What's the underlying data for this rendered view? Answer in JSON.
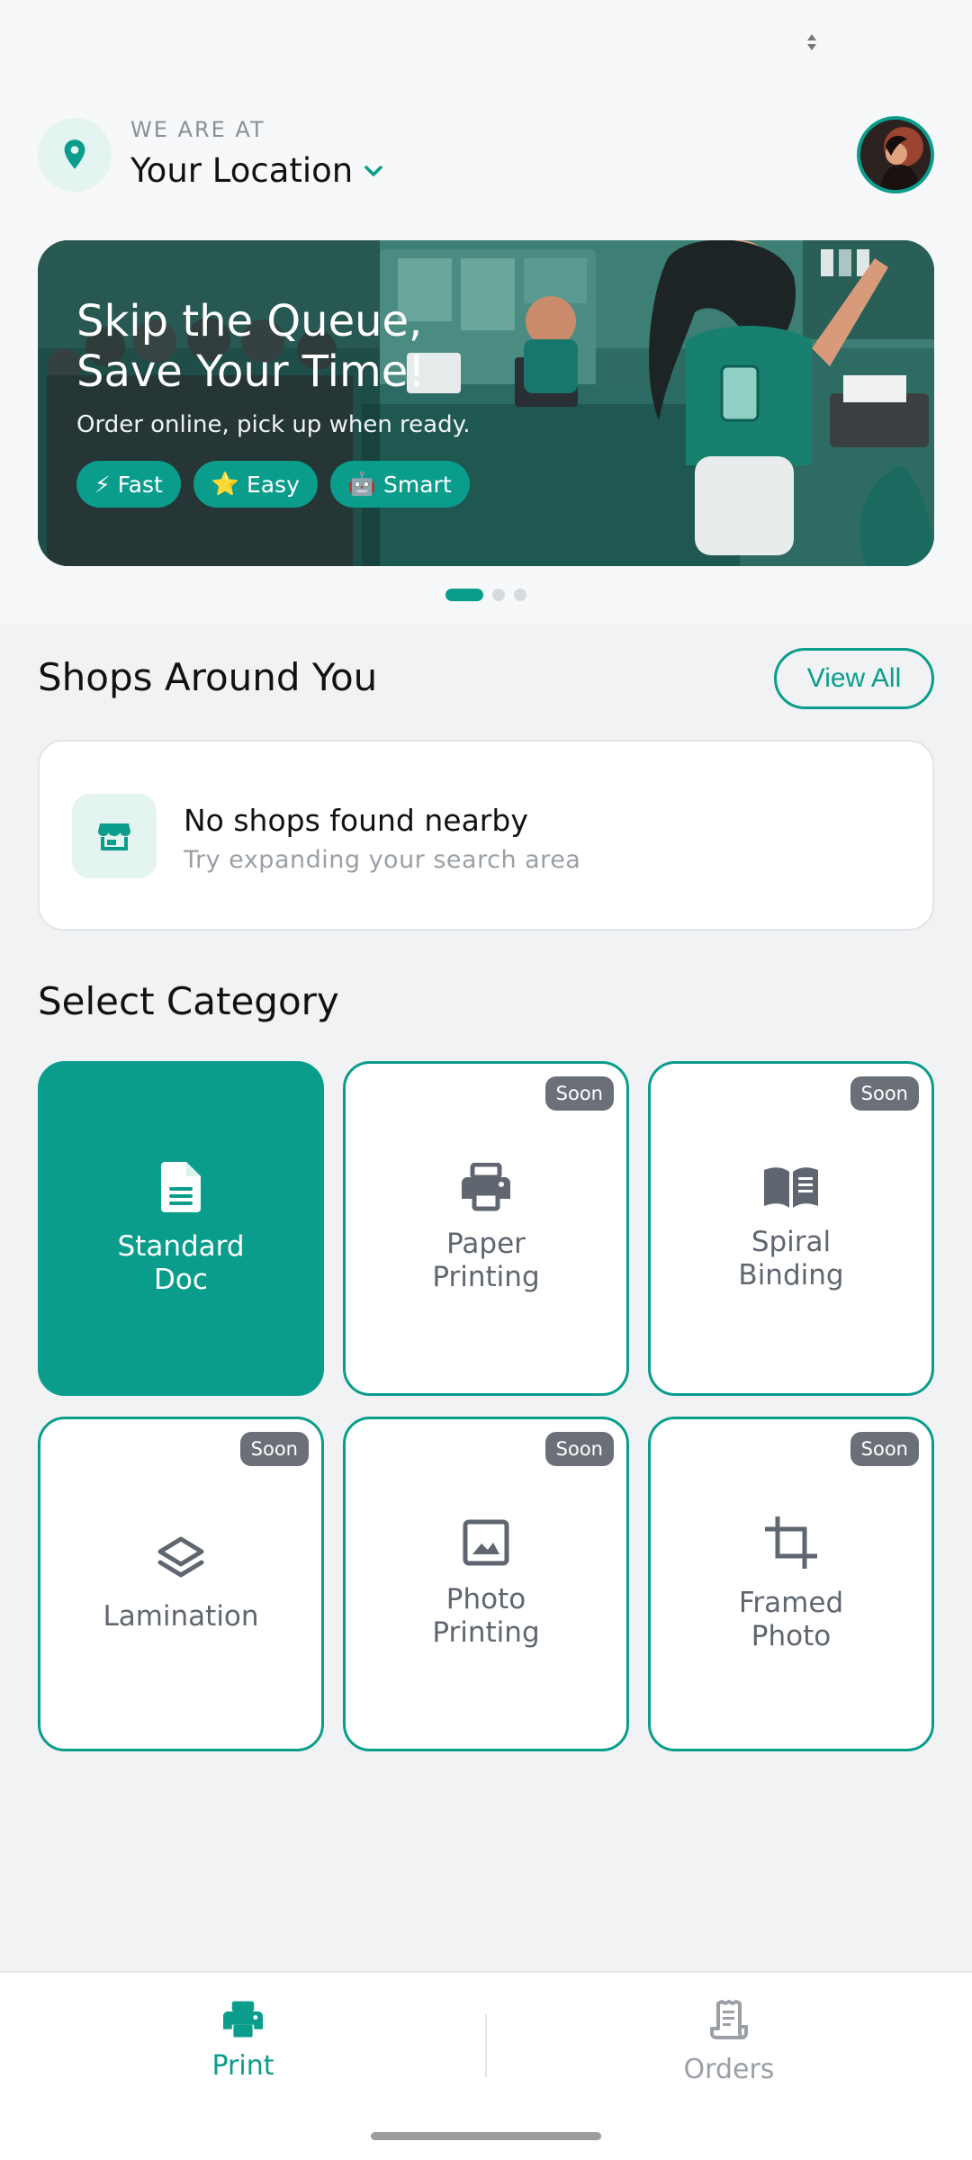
{
  "location": {
    "overline": "WE ARE AT",
    "title": "Your Location"
  },
  "banner": {
    "title_line1": "Skip the Queue,",
    "title_line2": "Save Your Time!",
    "subtitle": "Order online, pick up when ready.",
    "chips": [
      {
        "emoji": "⚡",
        "label": "Fast"
      },
      {
        "emoji": "⭐",
        "label": "Easy"
      },
      {
        "emoji": "🤖",
        "label": "Smart"
      }
    ],
    "pages": 3,
    "active_page": 1
  },
  "shops": {
    "title": "Shops Around You",
    "view_all": "View All",
    "empty_title": "No shops found nearby",
    "empty_subtitle": "Try expanding your search area"
  },
  "categories": {
    "title": "Select Category",
    "items": [
      {
        "label": "Standard\nDoc",
        "icon": "document-icon",
        "badge": "",
        "selected": true
      },
      {
        "label": "Paper\nPrinting",
        "icon": "printer-icon",
        "badge": "Soon",
        "selected": false
      },
      {
        "label": "Spiral\nBinding",
        "icon": "book-open-icon",
        "badge": "Soon",
        "selected": false
      },
      {
        "label": "Lamination",
        "icon": "layers-icon",
        "badge": "Soon",
        "selected": false
      },
      {
        "label": "Photo\nPrinting",
        "icon": "image-icon",
        "badge": "Soon",
        "selected": false
      },
      {
        "label": "Framed\nPhoto",
        "icon": "crop-icon",
        "badge": "Soon",
        "selected": false
      }
    ]
  },
  "bottom_nav": {
    "items": [
      {
        "label": "Print",
        "icon": "printer-icon",
        "active": true
      },
      {
        "label": "Orders",
        "icon": "receipt-icon",
        "active": false
      }
    ]
  },
  "colors": {
    "accent": "#0a9d8c",
    "badge": "#6b7078",
    "inactive": "#9aa0a6"
  }
}
